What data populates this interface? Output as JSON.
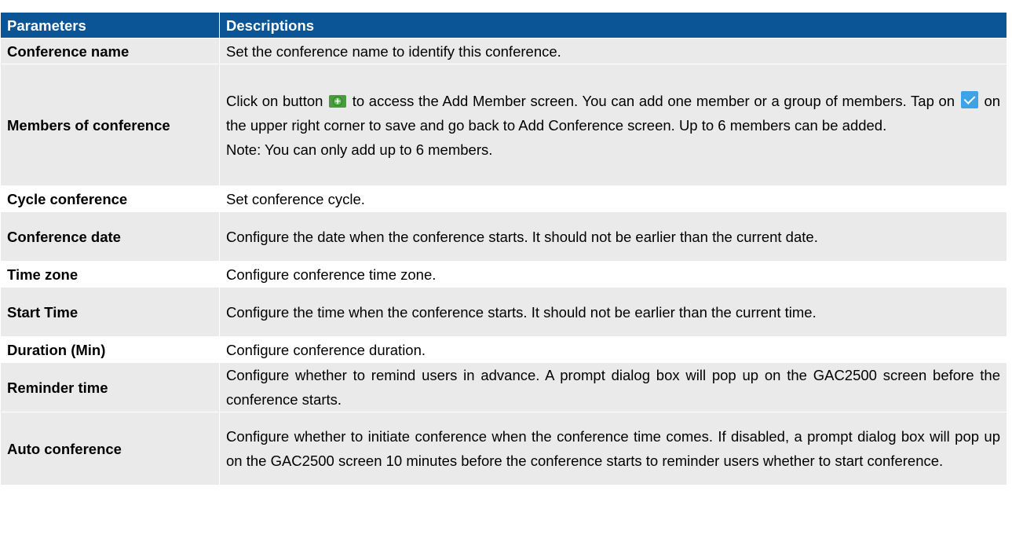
{
  "header": {
    "parameters": "Parameters",
    "descriptions": "Descriptions"
  },
  "rows": [
    {
      "param": "Conference name",
      "desc": "Set the conference name to identify this conference."
    },
    {
      "param": "Members of conference",
      "desc_part1": "Click on button",
      "desc_part2": "to access the Add Member screen. You can add one member or a group of members. Tap on",
      "desc_part3": "on the upper right corner to save and go back to Add Conference screen. Up to 6 members can be added.",
      "note": "Note: You can only add up to 6 members."
    },
    {
      "param": "Cycle conference",
      "desc": "Set conference cycle."
    },
    {
      "param": "Conference date",
      "desc": "Configure the date when the conference starts. It should not be earlier than the current date."
    },
    {
      "param": "Time zone",
      "desc": "Configure conference time zone."
    },
    {
      "param": "Start Time",
      "desc": "Configure the time when the conference starts. It should not be earlier than the current time."
    },
    {
      "param": "Duration (Min)",
      "desc": "Configure conference duration."
    },
    {
      "param": "Reminder time",
      "desc": "Configure whether to remind users in advance. A prompt dialog box will pop up on the GAC2500 screen before the conference starts."
    },
    {
      "param": "Auto conference",
      "desc": "Configure whether to initiate conference when the conference time comes. If disabled, a prompt dialog box will pop up on the GAC2500 screen 10 minutes before the conference starts to reminder users whether to start conference."
    }
  ],
  "colors": {
    "header_bg": "#0b5596",
    "shaded_row": "#eaeaea",
    "add_icon": "#56c04a",
    "check_icon": "#3ea3e6"
  },
  "icons": [
    "add-member-icon",
    "checkmark-icon"
  ]
}
